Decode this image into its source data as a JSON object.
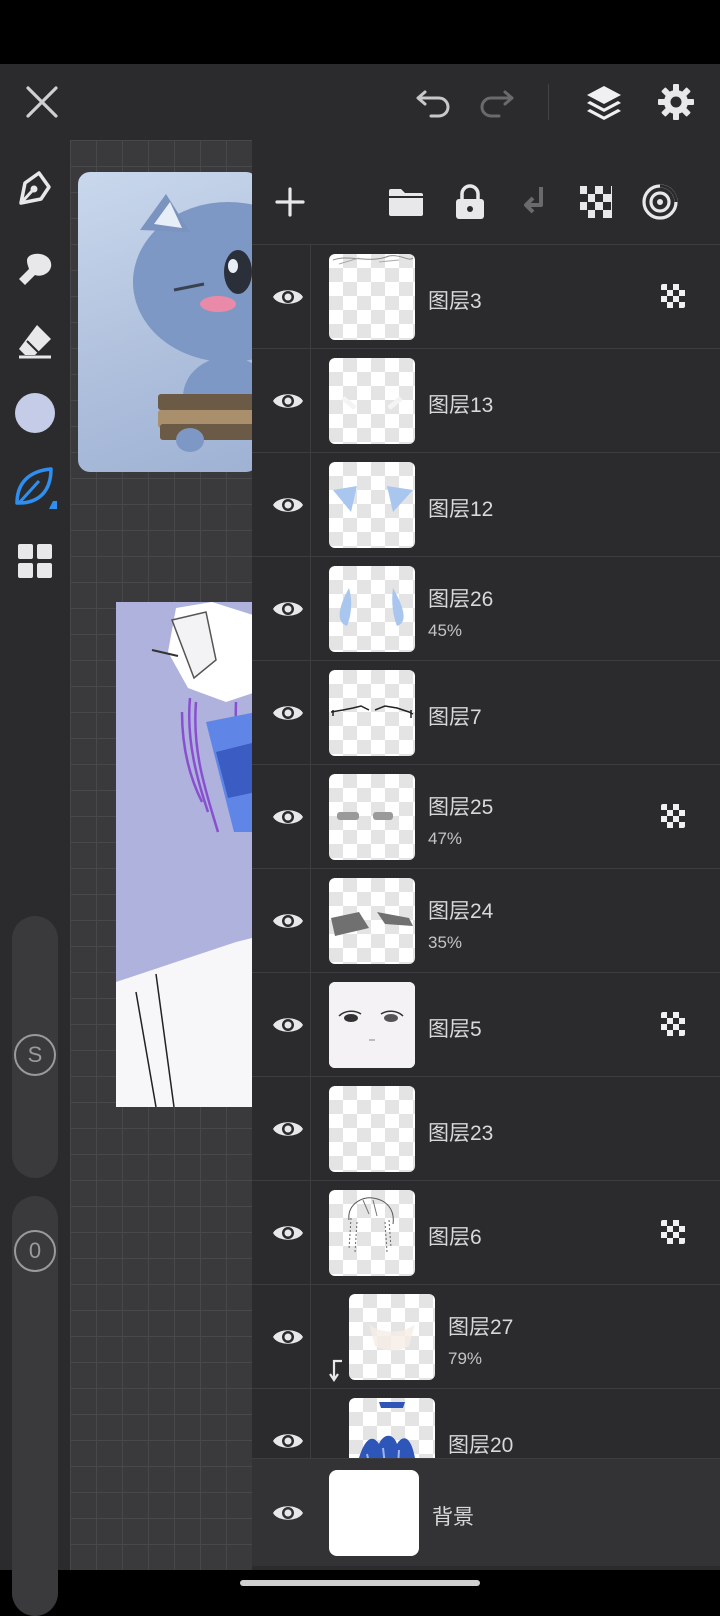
{
  "app": {
    "accent": "#2f8ff0",
    "current_color": "#c5cce8",
    "topbar_icons": [
      "close-icon",
      "undo-icon",
      "redo-icon",
      "layers-icon",
      "settings-icon"
    ],
    "left_tools": [
      "pen-icon",
      "smudge-icon",
      "eraser-icon",
      "color-swatch",
      "leaf-brush-icon",
      "grid-icon"
    ]
  },
  "sliders": {
    "size_label": "S",
    "opacity_label": "0"
  },
  "panel_toolbar": {
    "icons": [
      "add-layer-icon",
      "folder-icon",
      "lock-icon",
      "merge-down-icon",
      "alpha-checker-icon",
      "blend-mode-icon"
    ]
  },
  "layers": [
    {
      "name": "图层3",
      "opacity": "",
      "alpha_lock": true,
      "clipped": false
    },
    {
      "name": "图层13",
      "opacity": "",
      "alpha_lock": false,
      "clipped": false
    },
    {
      "name": "图层12",
      "opacity": "",
      "alpha_lock": false,
      "clipped": false
    },
    {
      "name": "图层26",
      "opacity": "45%",
      "alpha_lock": false,
      "clipped": false
    },
    {
      "name": "图层7",
      "opacity": "",
      "alpha_lock": false,
      "clipped": false
    },
    {
      "name": "图层25",
      "opacity": "47%",
      "alpha_lock": true,
      "clipped": false
    },
    {
      "name": "图层24",
      "opacity": "35%",
      "alpha_lock": false,
      "clipped": false
    },
    {
      "name": "图层5",
      "opacity": "",
      "alpha_lock": true,
      "clipped": false
    },
    {
      "name": "图层23",
      "opacity": "",
      "alpha_lock": false,
      "clipped": false
    },
    {
      "name": "图层6",
      "opacity": "",
      "alpha_lock": true,
      "clipped": false
    },
    {
      "name": "图层27",
      "opacity": "79%",
      "alpha_lock": false,
      "clipped": true
    },
    {
      "name": "图层20",
      "opacity": "",
      "alpha_lock": false,
      "clipped": true
    }
  ],
  "background_layer": {
    "name": "背景"
  }
}
